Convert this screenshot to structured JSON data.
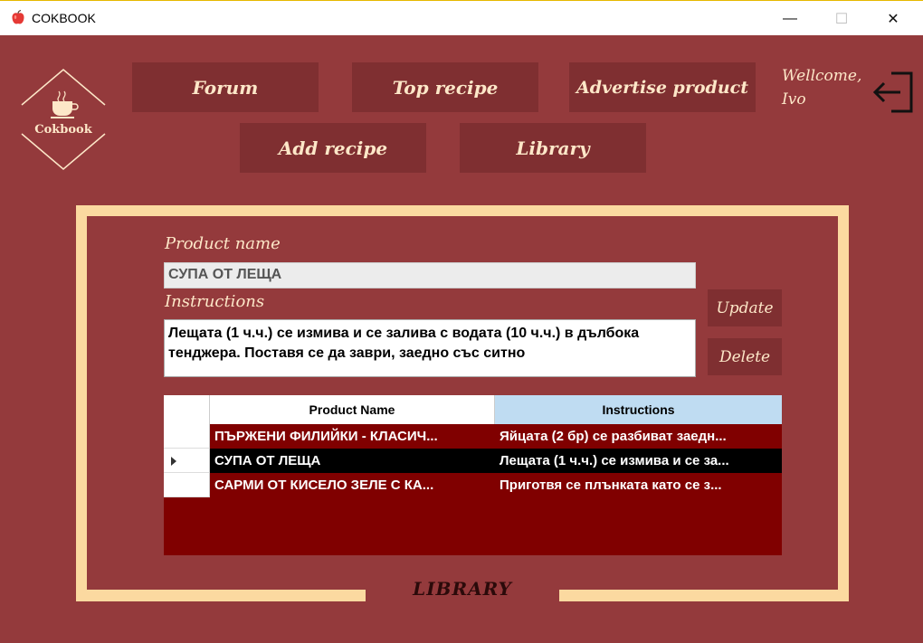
{
  "window": {
    "title": "COKBOOK",
    "minimize": "—",
    "maximize": "☐",
    "close": "✕"
  },
  "logo": {
    "text": "Cokbook"
  },
  "nav": {
    "forum": "Forum",
    "top_recipe": "Top recipe",
    "advertise": "Advertise product",
    "add_recipe": "Add recipe",
    "library": "Library"
  },
  "user": {
    "greeting": "Wellcome,",
    "name": "Ivo"
  },
  "form": {
    "product_name_label": "Product name",
    "product_name_value": "СУПА ОТ ЛЕЩА",
    "instructions_label": "Instructions",
    "instructions_value": "Лещата (1 ч.ч.) се измива и се залива с водата (10 ч.ч.) в дълбока тенджера. Поставя се да заври, заедно със ситно",
    "update_label": "Update",
    "delete_label": "Delete"
  },
  "grid": {
    "columns": [
      "Product Name",
      "Instructions"
    ],
    "rows": [
      {
        "name": "ПЪРЖЕНИ ФИЛИЙКИ - КЛАСИЧ...",
        "instructions": "Яйцата (2 бр) се разбиват заедн...",
        "selected": false
      },
      {
        "name": "СУПА ОТ ЛЕЩА",
        "instructions": "Лещата (1 ч.ч.) се измива и се за...",
        "selected": true
      },
      {
        "name": "САРМИ ОТ КИСЕЛО ЗЕЛЕ С КА...",
        "instructions": "Приготвя се плънката като се з...",
        "selected": false
      }
    ]
  },
  "frame": {
    "label": "LIBRARY"
  },
  "colors": {
    "background": "#943a3c",
    "button": "#7f2f31",
    "frame": "#fbd9a0",
    "grid": "#800000",
    "text_light": "#fde7c8"
  }
}
